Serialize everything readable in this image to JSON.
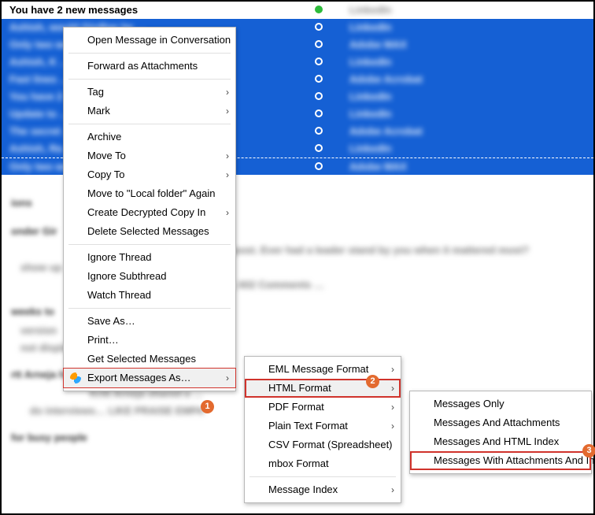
{
  "rows": [
    {
      "subject": "You have 2 new messages",
      "sender": "LinkedIn",
      "selected": false,
      "dot": "green"
    },
    {
      "subject": "Ashish, would Girdhar be …",
      "sender": "LinkedIn",
      "selected": true,
      "dot": "open"
    },
    {
      "subject": "Only two weeks on …",
      "sender": "Adobe MAX",
      "selected": true,
      "dot": "open"
    },
    {
      "subject": "Ashish, K …",
      "sender": "LinkedIn",
      "selected": true,
      "dot": "open"
    },
    {
      "subject": "Fast lines …",
      "sender": "Adobe Acrobat",
      "selected": true,
      "dot": "open"
    },
    {
      "subject": "You have 2 …",
      "sender": "LinkedIn",
      "selected": true,
      "dot": "open"
    },
    {
      "subject": "Update to …",
      "sender": "LinkedIn",
      "selected": true,
      "dot": "open"
    },
    {
      "subject": "The secret …",
      "sender": "Adobe Acrobat",
      "selected": true,
      "dot": "open"
    },
    {
      "subject": "Ashish, Ra …",
      "sender": "LinkedIn",
      "selected": true,
      "dot": "open"
    },
    {
      "subject": "Only two weeks …",
      "sender": "Adobe MAX",
      "selected": true,
      "dot": "open",
      "dashed": true
    }
  ],
  "detail": {
    "section1": "ions",
    "section1b": "onder Gir",
    "line1": "d a post. Ever had a leader stand by you when it mattered most?",
    "line2": "show up",
    "line3": "375, 602 Comments …",
    "section2": "weeks to",
    "line4": "version",
    "line5": "not displa",
    "section3": "rtt Arneja has a new post for you",
    "line6": "Kritt Arneja shared a …",
    "line7": "do interviews… LIKE PRAISE EMPA",
    "section4": "for busy people"
  },
  "menu1": {
    "open_conv": "Open Message in Conversation",
    "forward": "Forward as Attachments",
    "tag": "Tag",
    "mark": "Mark",
    "archive": "Archive",
    "move_to": "Move To",
    "copy_to": "Copy To",
    "move_again": "Move to \"Local folder\" Again",
    "create_decrypted": "Create Decrypted Copy In",
    "delete": "Delete Selected Messages",
    "ignore_thread": "Ignore Thread",
    "ignore_subthread": "Ignore Subthread",
    "watch_thread": "Watch Thread",
    "save_as": "Save As…",
    "print": "Print…",
    "get_selected": "Get Selected Messages",
    "export": "Export Messages As…"
  },
  "menu2": {
    "eml": "EML Message Format",
    "html": "HTML Format",
    "pdf": "PDF Format",
    "plain": "Plain Text Format",
    "csv": "CSV Format (Spreadsheet)",
    "mbox": "mbox Format",
    "index": "Message Index"
  },
  "menu3": {
    "only": "Messages Only",
    "attach": "Messages And Attachments",
    "htmlidx": "Messages And HTML Index",
    "full": "Messages With Attachments And Index"
  },
  "badges": {
    "b1": "1",
    "b2": "2",
    "b3": "3"
  }
}
